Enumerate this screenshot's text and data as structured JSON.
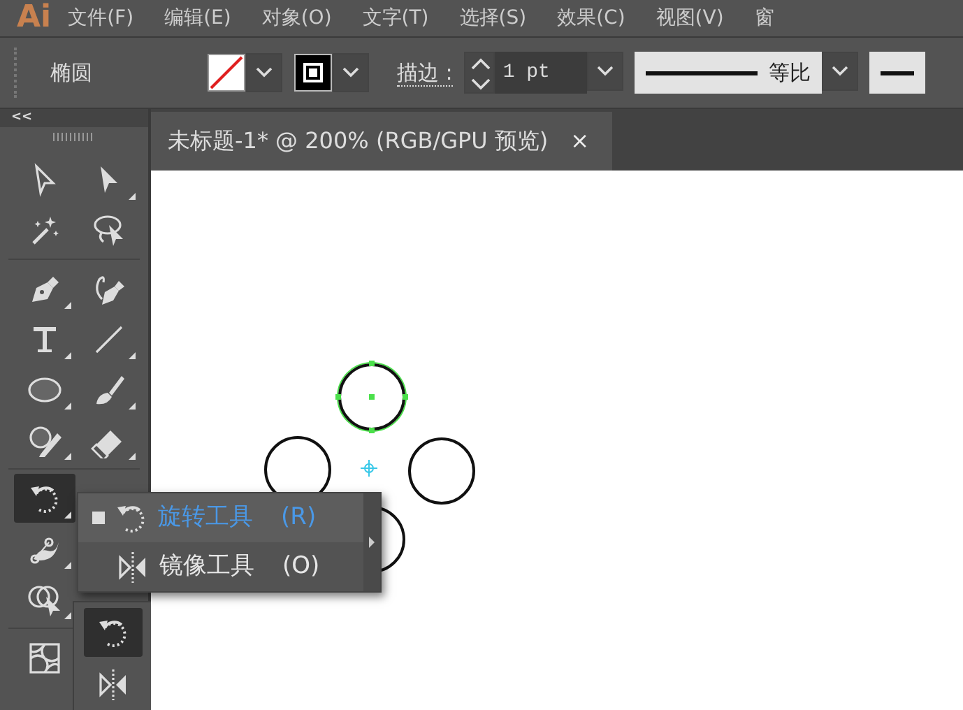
{
  "app": {
    "logo": "Ai"
  },
  "menu": [
    "文件(F)",
    "编辑(E)",
    "对象(O)",
    "文字(T)",
    "选择(S)",
    "效果(C)",
    "视图(V)",
    "窗"
  ],
  "control_bar": {
    "object_type": "椭圆",
    "stroke_label": "描边 :",
    "stroke_weight": "1 pt",
    "profile": "等比"
  },
  "toolbar": {
    "collapse": "<<",
    "groups": [
      [
        {
          "kind": "select",
          "selected": false,
          "more": false
        },
        {
          "kind": "direct-select",
          "selected": false,
          "more": true
        },
        {
          "kind": "magic-wand",
          "selected": false,
          "more": false
        },
        {
          "kind": "lasso",
          "selected": false,
          "more": false
        }
      ],
      [
        {
          "kind": "pen",
          "selected": false,
          "more": true
        },
        {
          "kind": "curvature",
          "selected": false,
          "more": false
        },
        {
          "kind": "type",
          "selected": false,
          "more": true
        },
        {
          "kind": "line",
          "selected": false,
          "more": true
        },
        {
          "kind": "ellipse",
          "selected": false,
          "more": true
        },
        {
          "kind": "brush",
          "selected": false,
          "more": true
        },
        {
          "kind": "shaper",
          "selected": false,
          "more": true
        },
        {
          "kind": "eraser",
          "selected": false,
          "more": true
        }
      ],
      [
        {
          "kind": "rotate",
          "selected": true,
          "more": true
        },
        {
          "kind": "blank"
        },
        {
          "kind": "puppet",
          "selected": false,
          "more": true
        },
        {
          "kind": "blank"
        },
        {
          "kind": "shape-builder",
          "selected": false,
          "more": true
        },
        {
          "kind": "blank"
        }
      ],
      [
        {
          "kind": "mesh",
          "selected": false,
          "more": false
        }
      ]
    ]
  },
  "document_tab": {
    "title": "未标题-1* @ 200% (RGB/GPU 预览)",
    "close": "×"
  },
  "canvas": {
    "circles": [
      {
        "selected": true
      },
      {
        "selected": false
      },
      {
        "selected": false
      },
      {
        "selected": false
      }
    ]
  },
  "flyout": {
    "items": [
      {
        "kind": "rotate",
        "label": "旋转工具",
        "shortcut": "(R)",
        "selected": true
      },
      {
        "kind": "reflect",
        "label": "镜像工具",
        "shortcut": "(O)",
        "selected": false
      }
    ]
  },
  "tearoff": {
    "tools": [
      {
        "kind": "rotate",
        "selected": true
      },
      {
        "kind": "reflect",
        "selected": false
      }
    ]
  }
}
